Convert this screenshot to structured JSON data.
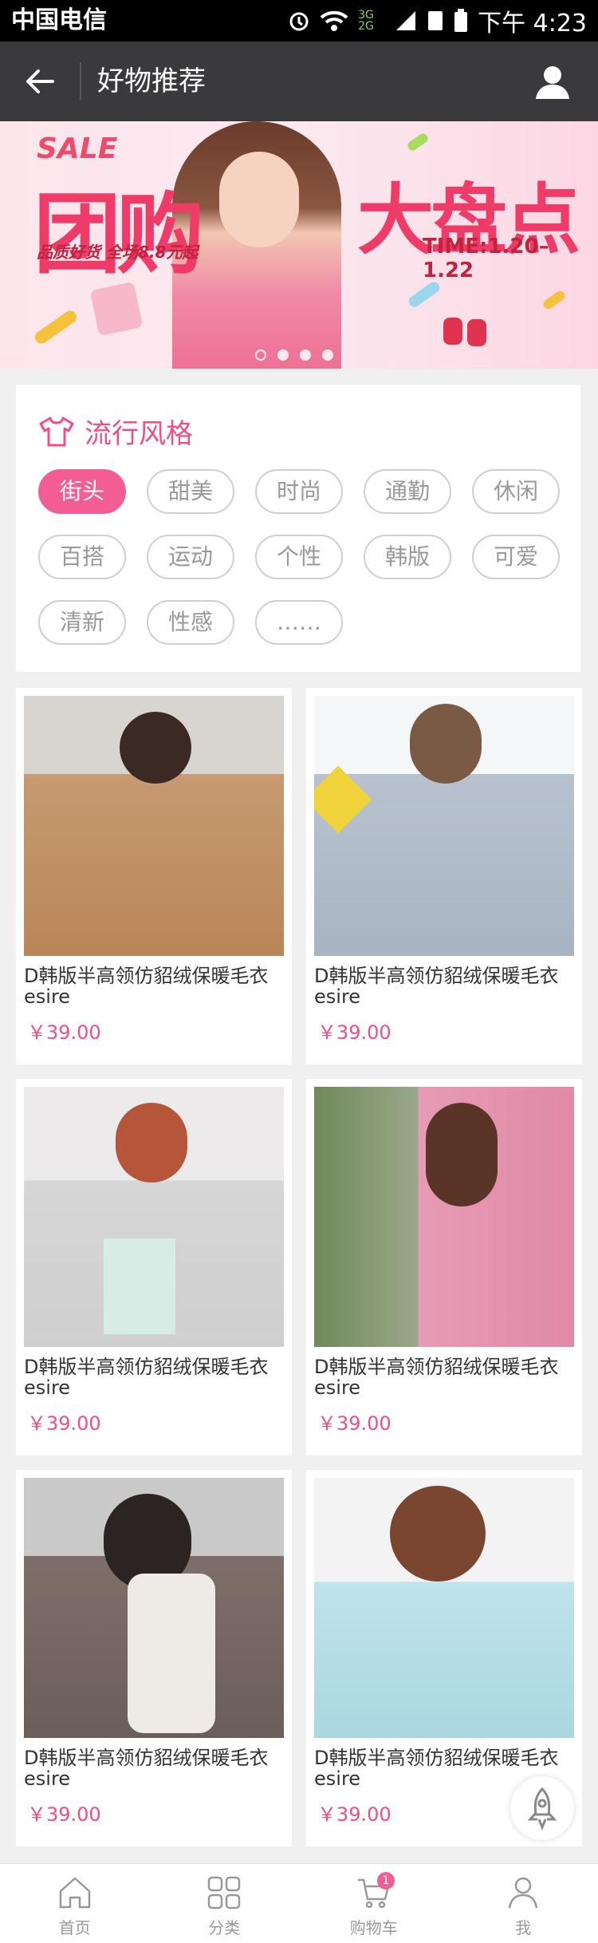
{
  "statusbar": {
    "carrier": "中国电信",
    "time": "下午 4:23",
    "network": "3G 2G"
  },
  "navbar": {
    "title": "好物推荐"
  },
  "banner": {
    "sale": "SALE",
    "headline": "团购",
    "subline": "品质好货 全场8.8元起",
    "big": "大盘点",
    "time": "TIME:1.20–1.22",
    "slides": 4,
    "active_slide": 0
  },
  "styles": {
    "title": "流行风格",
    "tags": [
      "街头",
      "甜美",
      "时尚",
      "通勤",
      "休闲",
      "百搭",
      "运动",
      "个性",
      "韩版",
      "可爱",
      "清新",
      "性感",
      "……"
    ],
    "active_index": 0
  },
  "products": [
    {
      "name": "D韩版半高领仿貂绒保暖毛衣esire",
      "price": "￥39.00",
      "swatch": "#c89a72"
    },
    {
      "name": "D韩版半高领仿貂绒保暖毛衣esire",
      "price": "￥39.00",
      "swatch": "#b8c2cf"
    },
    {
      "name": "D韩版半高领仿貂绒保暖毛衣esire",
      "price": "￥39.00",
      "swatch": "#d6d6d6"
    },
    {
      "name": "D韩版半高领仿貂绒保暖毛衣esire",
      "price": "￥39.00",
      "swatch": "#e69bb4"
    },
    {
      "name": "D韩版半高领仿貂绒保暖毛衣esire",
      "price": "￥39.00",
      "swatch": "#7f6f6a"
    },
    {
      "name": "D韩版半高领仿貂绒保暖毛衣esire",
      "price": "￥39.00",
      "swatch": "#bfe3ea"
    }
  ],
  "tabbar": {
    "items": [
      {
        "label": "首页",
        "icon": "home-icon"
      },
      {
        "label": "分类",
        "icon": "grid-icon"
      },
      {
        "label": "购物车",
        "icon": "cart-icon",
        "badge": "1"
      },
      {
        "label": "我",
        "icon": "user-icon"
      }
    ]
  },
  "colors": {
    "accent": "#f25d93",
    "nav": "#3a3a3c",
    "price": "#ef4f83"
  }
}
